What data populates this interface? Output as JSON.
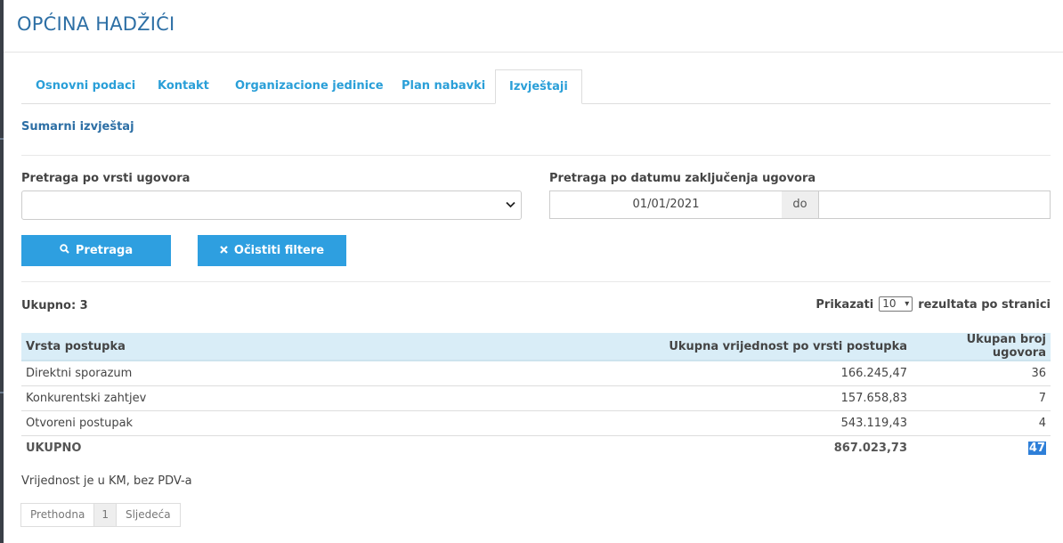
{
  "header": {
    "title": "OPĆINA HADŽIĆI"
  },
  "tabs": [
    {
      "label": "Osnovni podaci"
    },
    {
      "label": "Kontakt"
    },
    {
      "label": "Organizacione jedinice"
    },
    {
      "label": "Plan nabavki"
    },
    {
      "label": "Izvještaji"
    }
  ],
  "section": {
    "title": "Sumarni izvještaj"
  },
  "filters": {
    "type_label": "Pretraga po vrsti ugovora",
    "type_value": "",
    "date_label": "Pretraga po datumu zaključenja ugovora",
    "date_from": "01/01/2021",
    "date_sep": "do",
    "date_to": ""
  },
  "buttons": {
    "search": "Pretraga",
    "clear": "Očistiti filtere"
  },
  "summary": {
    "total_label": "Ukupno: 3",
    "show_label": "Prikazati",
    "per_page": "10",
    "per_page_suffix": "rezultata po stranici"
  },
  "table": {
    "headers": [
      "Vrsta postupka",
      "Ukupna vrijednost po vrsti postupka",
      "Ukupan broj ugovora"
    ],
    "rows": [
      [
        "Direktni sporazum",
        "166.245,47",
        "36"
      ],
      [
        "Konkurentski zahtjev",
        "157.658,83",
        "7"
      ],
      [
        "Otvoreni postupak",
        "543.119,43",
        "4"
      ]
    ],
    "total": [
      "UKUPNO",
      "867.023,73",
      "47"
    ]
  },
  "note": "Vrijednost je u KM, bez PDV-a",
  "pagination": {
    "prev": "Prethodna",
    "page": "1",
    "next": "Sljedeća"
  },
  "icons": {
    "search": "search-icon",
    "clear": "close-icon",
    "select": "chevron-down-icon"
  },
  "colors": {
    "accent": "#2e9fe0",
    "title": "#2d6fa5",
    "table_header": "#d9edf7"
  }
}
